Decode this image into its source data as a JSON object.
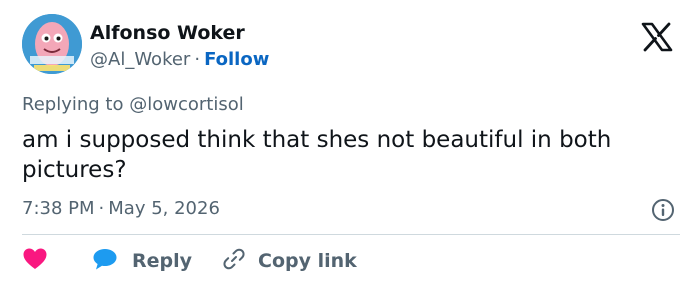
{
  "author": {
    "name": "Alfonso Woker",
    "handle": "@Al_Woker",
    "separator": "·",
    "follow_label": "Follow"
  },
  "icons": {
    "logo": "x-logo-icon",
    "like": "heart-icon",
    "reply": "speech-bubble-icon",
    "copy": "link-icon",
    "info": "info-icon"
  },
  "reply_context": {
    "prefix": "Replying to",
    "mention": "@lowcortisol"
  },
  "tweet": {
    "text": "am i supposed think that shes not beautiful in both pictures?",
    "time": "7:38 PM",
    "separator": "·",
    "date": "May 5, 2026"
  },
  "actions": {
    "reply_label": "Reply",
    "copy_label": "Copy link"
  },
  "colors": {
    "like": "#f91880",
    "reply": "#1d9bf0",
    "follow": "#0a66c2",
    "secondary_text": "#536471"
  }
}
